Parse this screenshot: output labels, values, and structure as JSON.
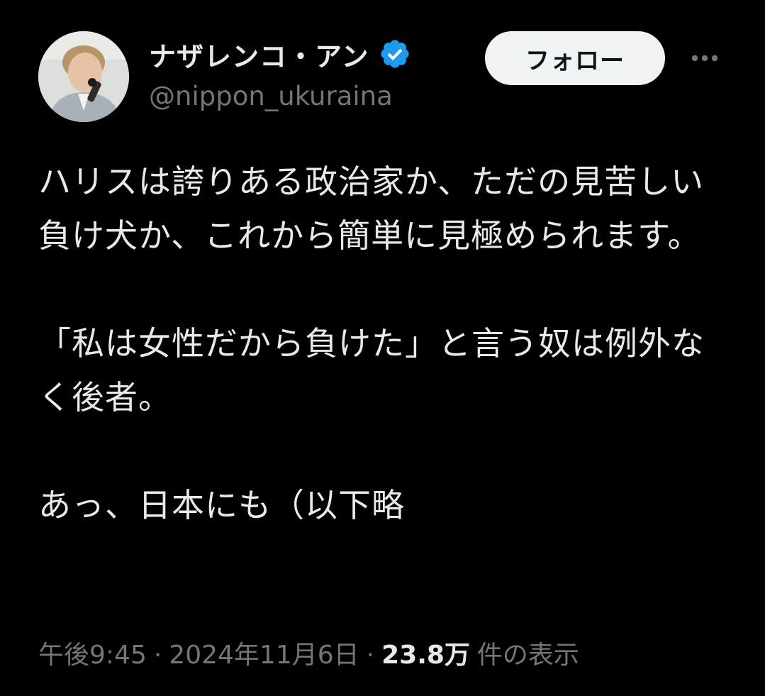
{
  "author": {
    "display_name": "ナザレンコ・アン",
    "handle": "@nippon_ukuraina",
    "verified": true,
    "avatar_icon": "profile-photo"
  },
  "actions": {
    "follow_label": "フォロー",
    "more_icon": "more-horizontal-icon"
  },
  "tweet": {
    "paragraphs": [
      "ハリスは誇りある政治家か、ただの見苦しい負け犬か、これから簡単に見極められます。",
      "「私は女性だから負けた」と言う奴は例外なく後者。",
      "あっ、日本にも（以下略"
    ]
  },
  "meta": {
    "time": "午後9:45",
    "separator": "·",
    "date": "2024年11月6日",
    "views_count": "23.8万",
    "views_label": "件の表示"
  },
  "colors": {
    "background": "#000000",
    "text_primary": "#e7e9ea",
    "text_secondary": "#71767b",
    "verified_blue": "#1d9bf0",
    "follow_bg": "#eff3f4"
  }
}
